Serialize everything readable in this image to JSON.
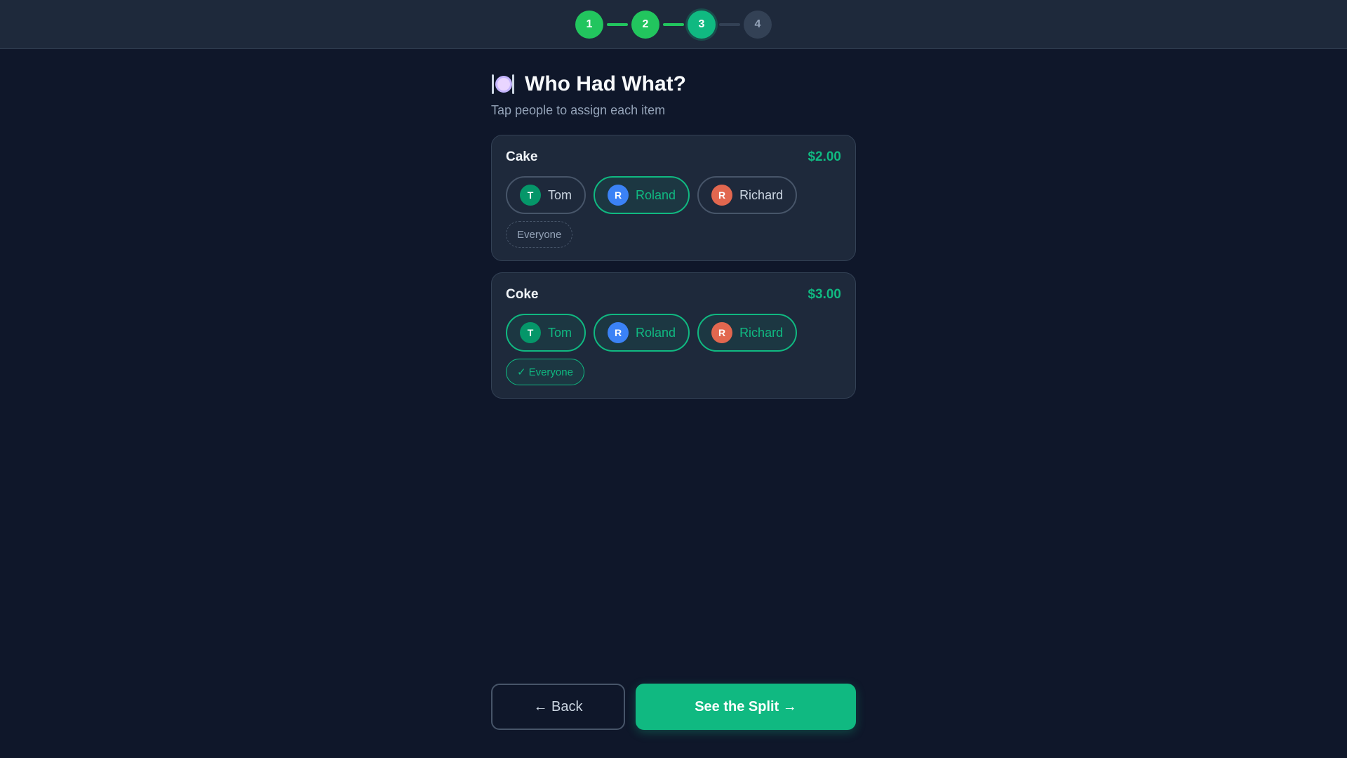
{
  "stepper": {
    "steps": [
      "1",
      "2",
      "3",
      "4"
    ],
    "current": 3,
    "colors": {
      "done": "#22c55e",
      "current": "#10b981",
      "todo": "#334155"
    }
  },
  "page": {
    "icon": "plate-fork-knife-icon",
    "title": "Who Had What?",
    "subtitle": "Tap people to assign each item"
  },
  "items": [
    {
      "name": "Cake",
      "price": "$2.00",
      "people": [
        {
          "initial": "T",
          "name": "Tom",
          "selected": false
        },
        {
          "initial": "R",
          "name": "Roland",
          "selected": true
        },
        {
          "initial": "R",
          "name": "Richard",
          "selected": false
        }
      ],
      "everyone_label": "Everyone",
      "everyone_selected": false
    },
    {
      "name": "Coke",
      "price": "$3.00",
      "people": [
        {
          "initial": "T",
          "name": "Tom",
          "selected": true
        },
        {
          "initial": "R",
          "name": "Roland",
          "selected": true
        },
        {
          "initial": "R",
          "name": "Richard",
          "selected": true
        }
      ],
      "everyone_label": "Everyone",
      "everyone_selected": true
    }
  ],
  "person_colors": {
    "Tom": "#059669",
    "Roland": "#3b82f6",
    "Richard": "#e2674f"
  },
  "accent": "#10b981",
  "footer": {
    "back_label": "← Back",
    "next_label": "See the Split →"
  }
}
